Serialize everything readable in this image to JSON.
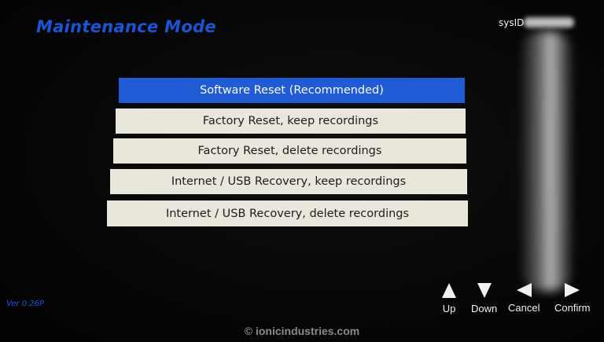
{
  "header": {
    "title": "Maintenance Mode",
    "sysid_label": "sysID"
  },
  "menu": {
    "items": [
      {
        "label": "Software Reset (Recommended)",
        "selected": true
      },
      {
        "label": "Factory Reset, keep recordings",
        "selected": false
      },
      {
        "label": "Factory Reset, delete recordings",
        "selected": false
      },
      {
        "label": "Internet / USB Recovery, keep recordings",
        "selected": false
      },
      {
        "label": "Internet / USB Recovery, delete recordings",
        "selected": false
      }
    ]
  },
  "footer": {
    "version": "Ver 0.26P",
    "watermark": "© ionicindustries.com",
    "nav": {
      "up": {
        "label": "Up",
        "icon": "up-arrow-icon"
      },
      "down": {
        "label": "Down",
        "icon": "down-arrow-icon"
      },
      "cancel": {
        "label": "Cancel",
        "icon": "left-arrow-icon"
      },
      "confirm": {
        "label": "Confirm",
        "icon": "right-arrow-icon"
      }
    }
  },
  "colors": {
    "accent": "#1f5bd4",
    "title": "#1a55d8",
    "menu_bg": "#e9e6dc"
  }
}
